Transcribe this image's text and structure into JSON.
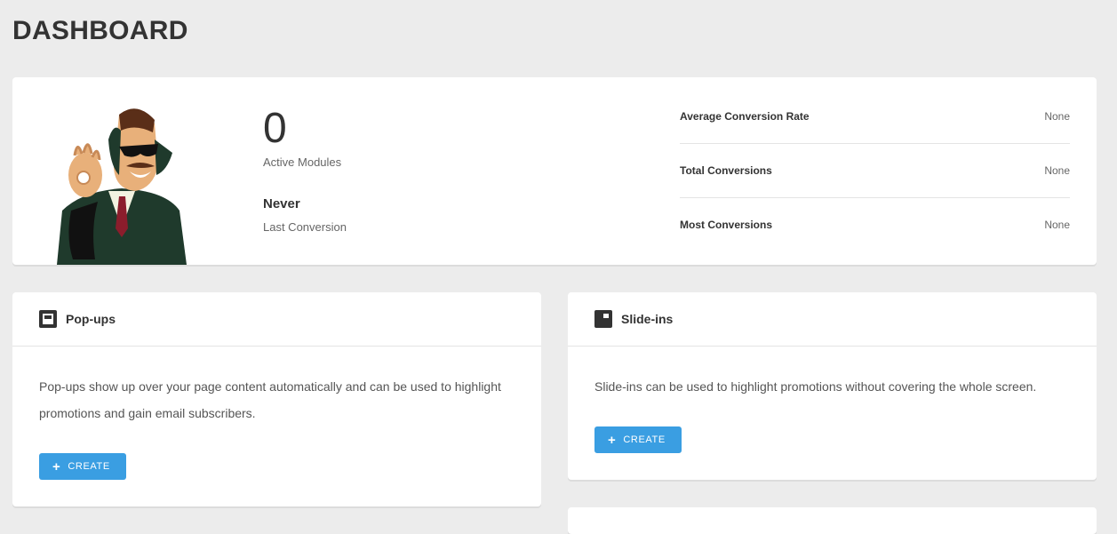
{
  "page": {
    "title": "DASHBOARD"
  },
  "summary": {
    "active_modules_count": "0",
    "active_modules_label": "Active Modules",
    "last_conversion_value": "Never",
    "last_conversion_label": "Last Conversion",
    "stats": [
      {
        "label": "Average Conversion Rate",
        "value": "None"
      },
      {
        "label": "Total Conversions",
        "value": "None"
      },
      {
        "label": "Most Conversions",
        "value": "None"
      }
    ]
  },
  "modules": {
    "popups": {
      "title": "Pop-ups",
      "icon": "popup-icon",
      "description": "Pop-ups show up over your page content automatically and can be used to highlight promotions and gain email subscribers.",
      "button_label": "CREATE"
    },
    "slideins": {
      "title": "Slide-ins",
      "icon": "slide-in-icon",
      "description": "Slide-ins can be used to highlight promotions without covering the whole screen.",
      "button_label": "CREATE"
    }
  },
  "colors": {
    "accent": "#3a9ee2",
    "background": "#ececec",
    "card": "#ffffff"
  }
}
